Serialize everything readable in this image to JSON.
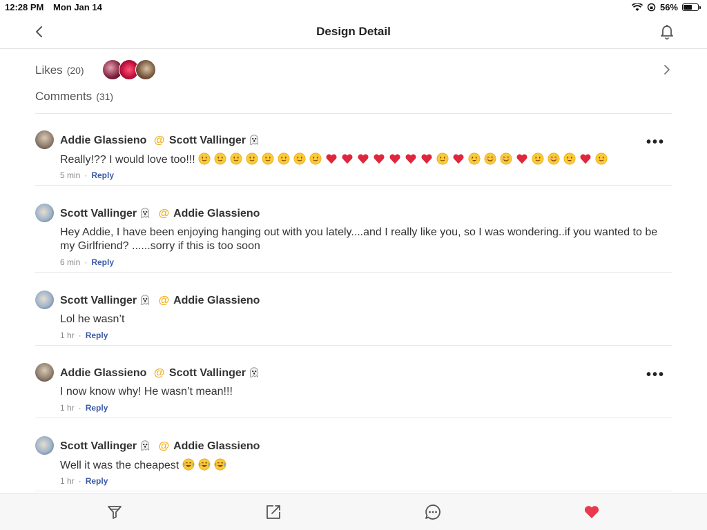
{
  "status_bar": {
    "time": "12:28 PM",
    "date": "Mon Jan 14",
    "battery": "56%"
  },
  "nav": {
    "title": "Design Detail"
  },
  "likes": {
    "label": "Likes",
    "count": "(20)"
  },
  "comments_section": {
    "label": "Comments",
    "count": "(31)"
  },
  "comments": [
    {
      "author": "Addie Glassieno",
      "mention": "@",
      "mention_name": "Scott Vallinger",
      "text_prefix": "Really!?? I would love too!!!",
      "emojis": [
        "smile",
        "smile",
        "smile",
        "smile",
        "smile",
        "smile",
        "smile",
        "smile",
        "heart",
        "heart",
        "heart",
        "heart",
        "heart",
        "heart",
        "heart",
        "smile",
        "heart",
        "grin",
        "blush",
        "blush",
        "heart",
        "smile",
        "blush",
        "grin",
        "heart",
        "smile"
      ],
      "time": "5 min",
      "reply": "Reply"
    },
    {
      "author": "Scott Vallinger",
      "mention": "@",
      "mention_name": "Addie Glassieno",
      "text": "Hey Addie, I have been enjoying hanging out with you lately....and I really like you, so I was wondering..if you wanted to be my Girlfriend? ......sorry if this is too soon",
      "time": "6 min",
      "reply": "Reply"
    },
    {
      "author": "Scott Vallinger",
      "mention": "@",
      "mention_name": "Addie Glassieno",
      "text": "Lol he wasn’t",
      "time": "1 hr",
      "reply": "Reply"
    },
    {
      "author": "Addie Glassieno",
      "mention": "@",
      "mention_name": "Scott Vallinger",
      "text": "I now know why!  He wasn’t mean!!!",
      "time": "1 hr",
      "reply": "Reply"
    },
    {
      "author": "Scott Vallinger",
      "mention": "@",
      "mention_name": "Addie Glassieno",
      "text_prefix": "Well it was the cheapest",
      "emojis": [
        "joy",
        "joy",
        "joy"
      ],
      "time": "1 hr",
      "reply": "Reply"
    }
  ],
  "more_label": "•••",
  "colors": {
    "accent_heart": "#e8394d",
    "reply_link": "#3b5aa8",
    "mention_at": "#f0b020"
  },
  "tabbar": {
    "icons": [
      "filter-icon",
      "share-icon",
      "comment-icon",
      "heart-icon"
    ]
  }
}
